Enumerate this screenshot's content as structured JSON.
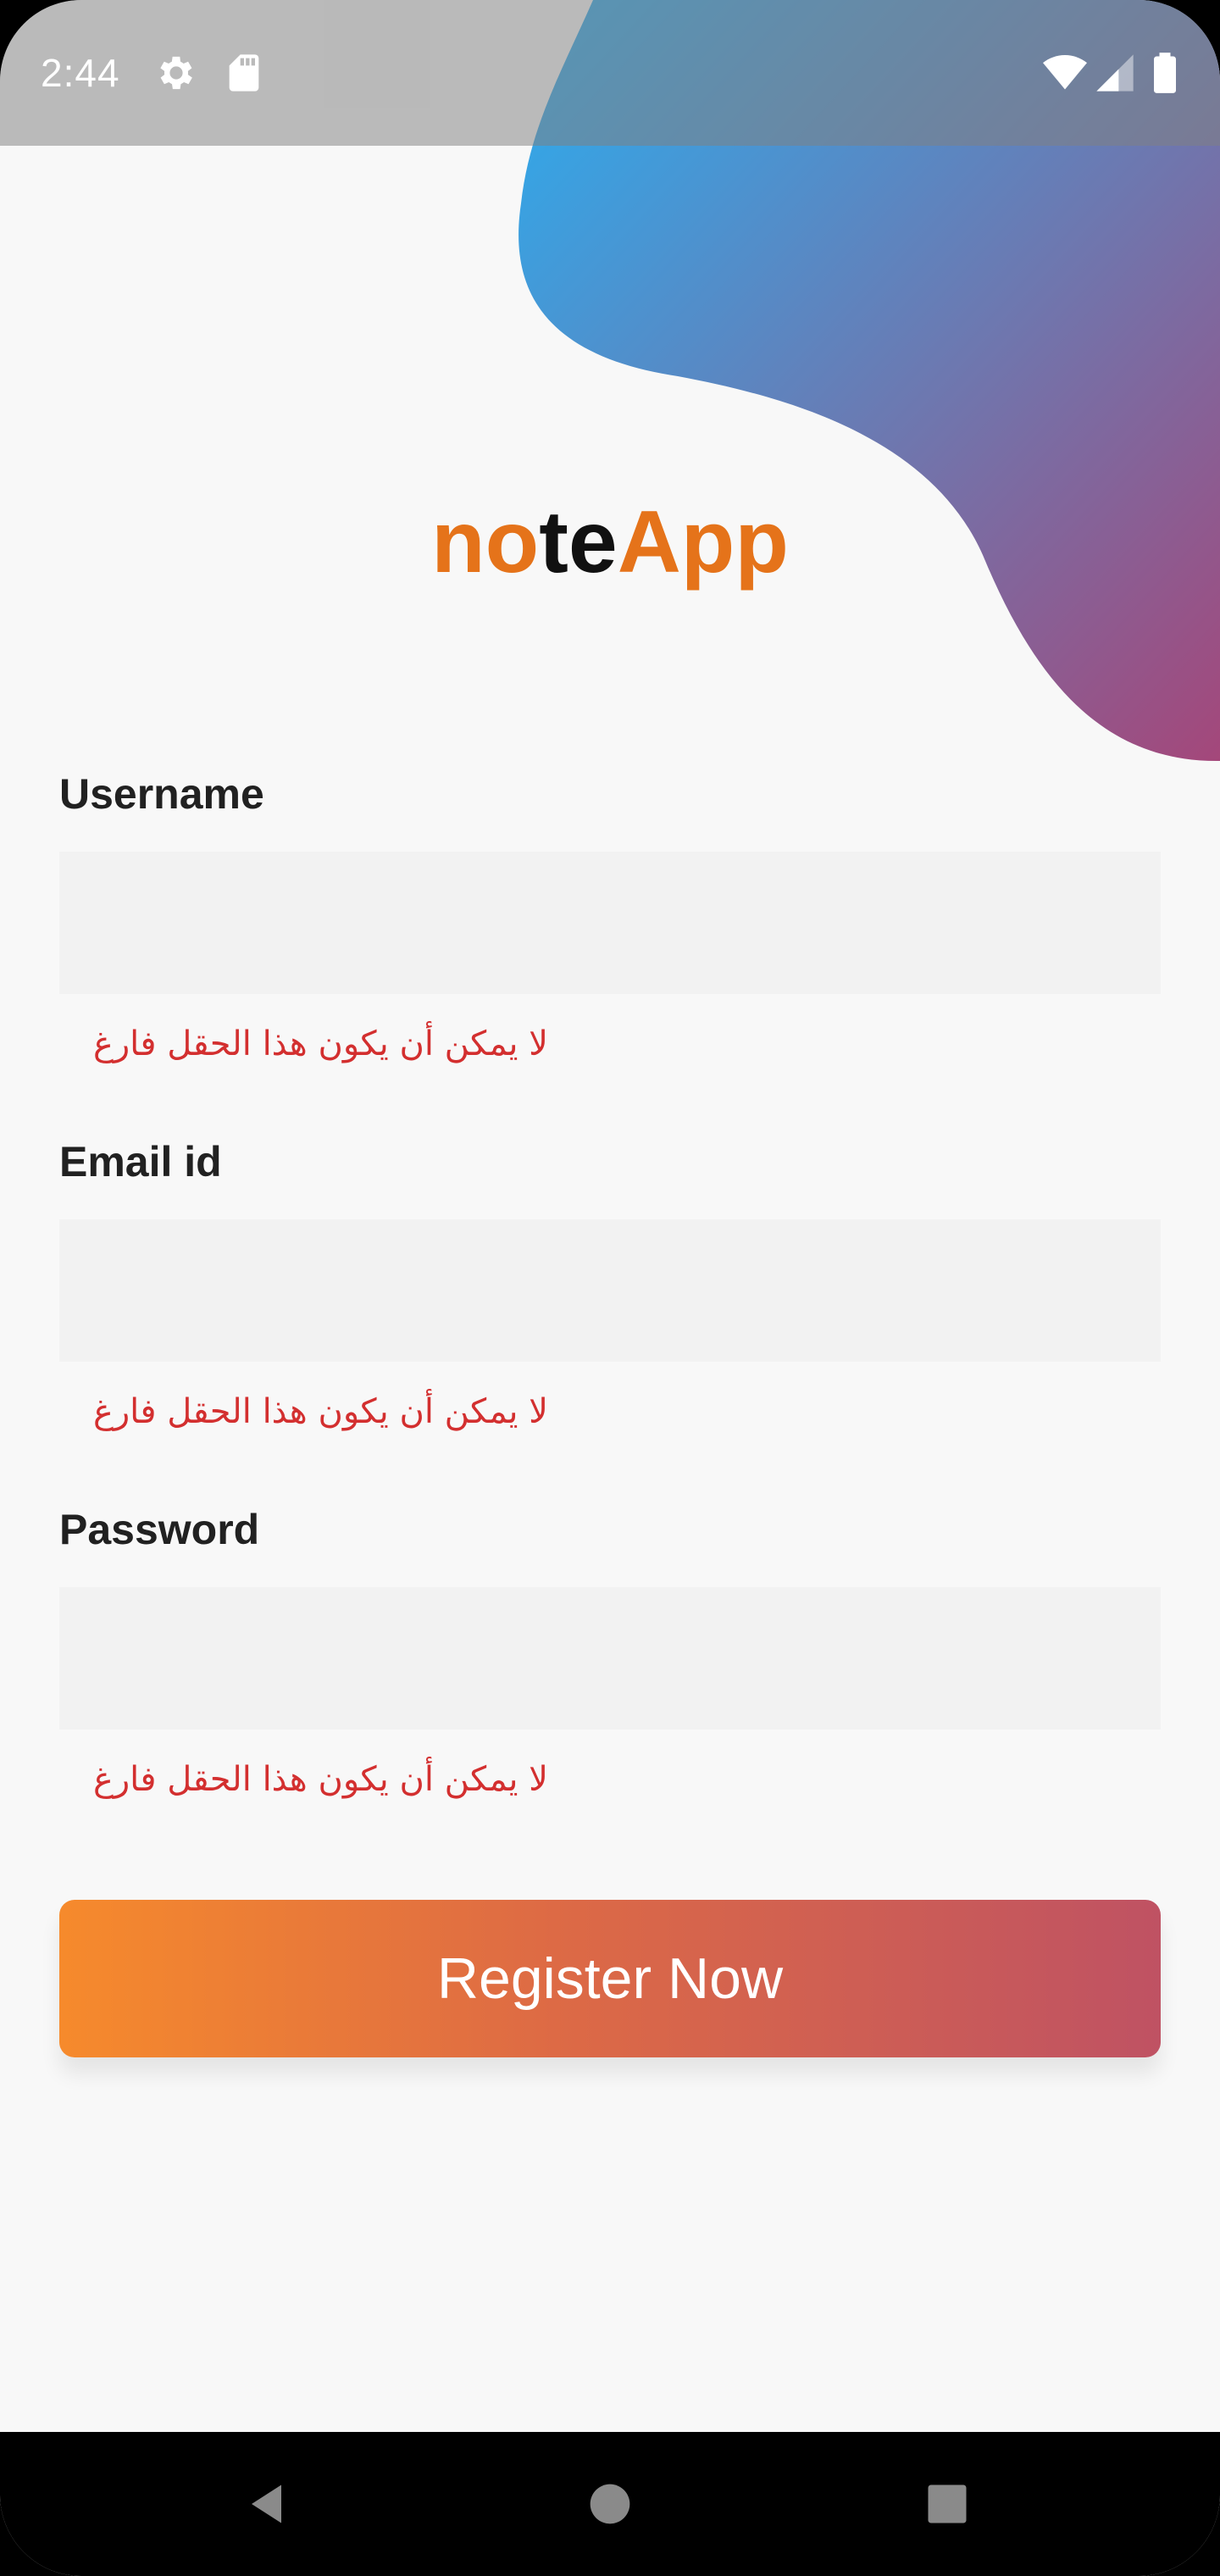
{
  "status_bar": {
    "time": "2:44",
    "icons": [
      "gear-icon",
      "sd-card-icon",
      "wifi-icon",
      "cell-signal-icon",
      "battery-icon"
    ]
  },
  "app": {
    "title_parts": [
      "no",
      "te",
      "App"
    ],
    "title_colors": {
      "accent": "#e5731a",
      "dark": "#111111"
    }
  },
  "form": {
    "username": {
      "label": "Username",
      "value": "",
      "error": "لا يمكن أن يكون هذا الحقل فارغ"
    },
    "email": {
      "label": "Email id",
      "value": "",
      "error": "لا يمكن أن يكون هذا الحقل فارغ"
    },
    "password": {
      "label": "Password",
      "value": "",
      "error": "لا يمكن أن يكون هذا الحقل فارغ"
    },
    "submit_label": "Register Now"
  },
  "colors": {
    "error": "#d32f2f",
    "button_gradient": [
      "#f68a2c",
      "#bf5263"
    ],
    "blob_gradient": [
      "#2aaef0",
      "#a4477a"
    ]
  },
  "nav_bar": {
    "buttons": [
      "back-icon",
      "home-icon",
      "recents-icon"
    ]
  }
}
